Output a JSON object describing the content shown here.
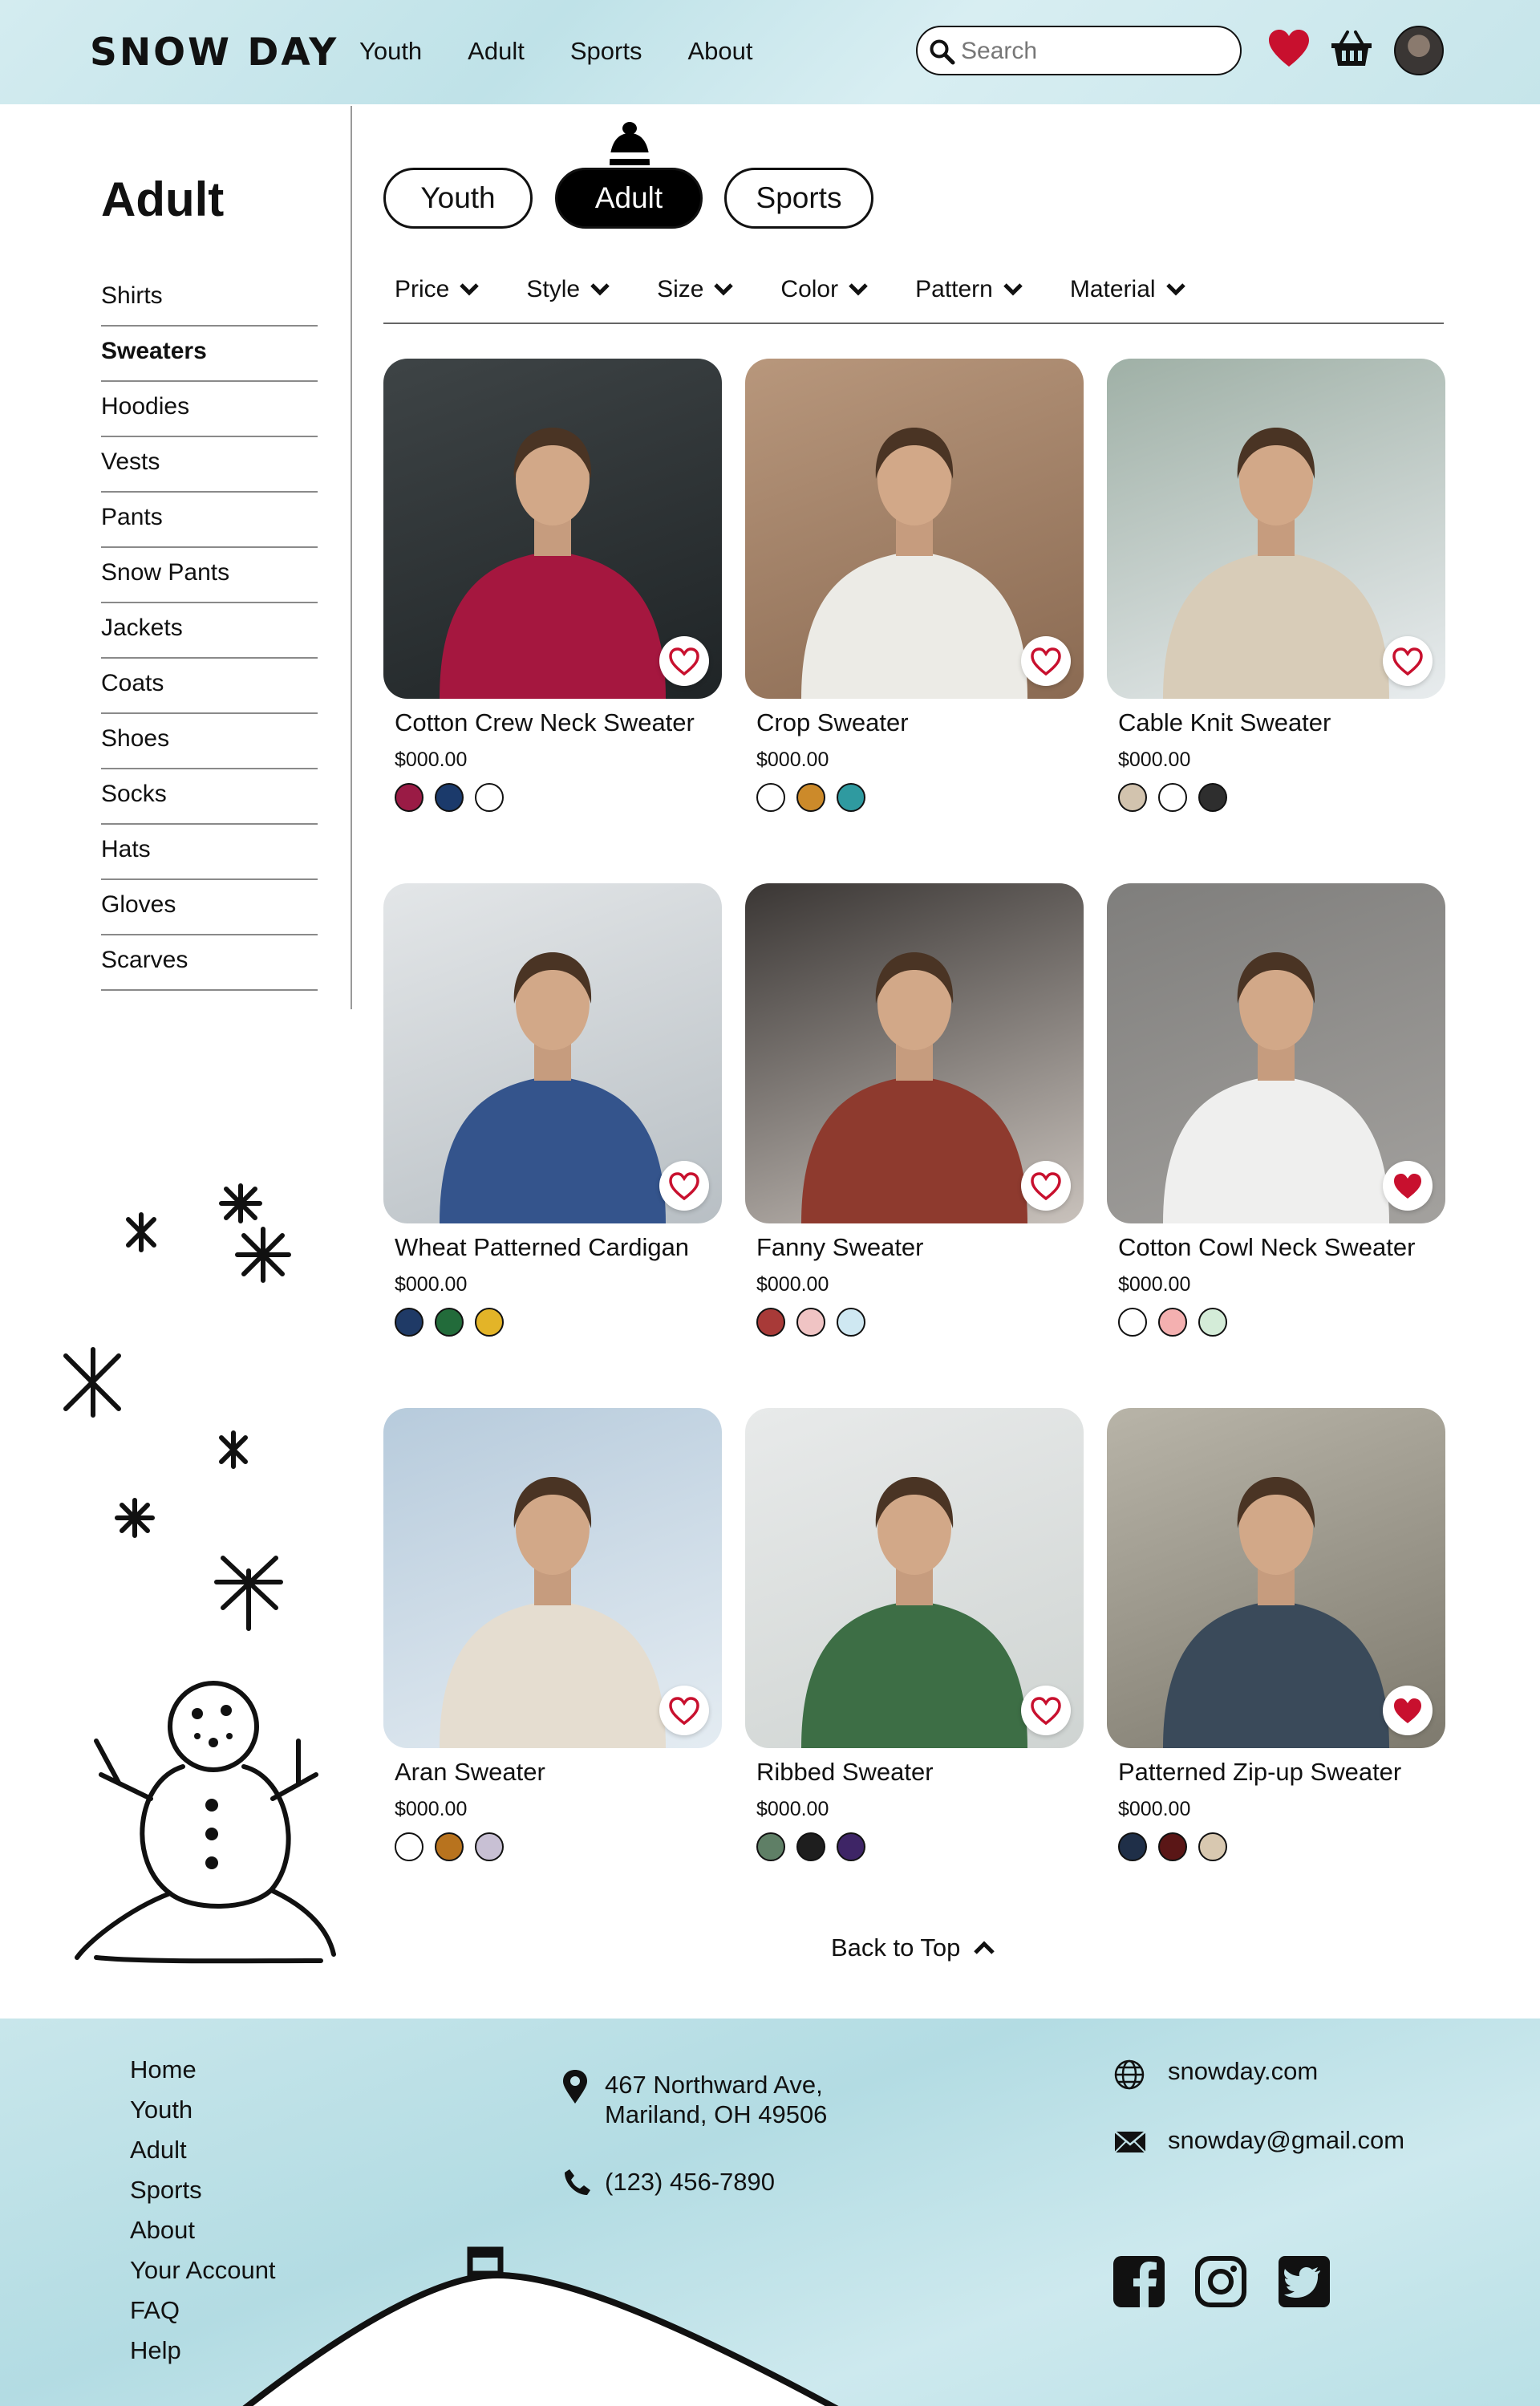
{
  "brand": "SNOW DAY",
  "nav": [
    "Youth",
    "Adult",
    "Sports",
    "About"
  ],
  "search": {
    "placeholder": "Search"
  },
  "sidebar": {
    "title": "Adult",
    "items": [
      "Shirts",
      "Sweaters",
      "Hoodies",
      "Vests",
      "Pants",
      "Snow Pants",
      "Jackets",
      "Coats",
      "Shoes",
      "Socks",
      "Hats",
      "Gloves",
      "Scarves"
    ],
    "active": "Sweaters"
  },
  "tabs": [
    {
      "label": "Youth",
      "active": false
    },
    {
      "label": "Adult",
      "active": true
    },
    {
      "label": "Sports",
      "active": false
    }
  ],
  "filters": [
    "Price",
    "Style",
    "Size",
    "Color",
    "Pattern",
    "Material"
  ],
  "products": [
    {
      "name": "Cotton Crew Neck Sweater",
      "price": "$000.00",
      "favorited": false,
      "icon": "crewneck-photo",
      "bg": [
        "#3e4446",
        "#1f2426"
      ],
      "figure": "#a5173f",
      "colors": [
        "#9a1b45",
        "#1b3a6b",
        "#ffffff"
      ]
    },
    {
      "name": "Crop Sweater",
      "price": "$000.00",
      "favorited": false,
      "icon": "crop-photo",
      "bg": [
        "#b8977c",
        "#8a6a52"
      ],
      "figure": "#ecebe6",
      "colors": [
        "#ffffff",
        "#cc8a2a",
        "#2f9aa0"
      ]
    },
    {
      "name": "Cable Knit Sweater",
      "price": "$000.00",
      "favorited": false,
      "icon": "cable-photo",
      "bg": [
        "#9fb0a6",
        "#e8ecee"
      ],
      "figure": "#d8ccb8",
      "colors": [
        "#d2c3ae",
        "#ffffff",
        "#2e2e2e"
      ]
    },
    {
      "name": "Wheat Patterned Cardigan",
      "price": "$000.00",
      "favorited": false,
      "icon": "cardigan-photo",
      "bg": [
        "#e3e6e8",
        "#b8bfc4"
      ],
      "figure": "#34548c",
      "colors": [
        "#1f3a66",
        "#226b3a",
        "#e3b428"
      ]
    },
    {
      "name": "Fanny Sweater",
      "price": "$000.00",
      "favorited": false,
      "icon": "fanny-photo",
      "bg": [
        "#3a3634",
        "#c9c2bc"
      ],
      "figure": "#8e3a2e",
      "colors": [
        "#a83a38",
        "#f0c4c4",
        "#cfe8f2"
      ]
    },
    {
      "name": "Cotton Cowl Neck Sweater",
      "price": "$000.00",
      "favorited": true,
      "icon": "cowl-photo",
      "bg": [
        "#7f7e7c",
        "#a3a19e"
      ],
      "figure": "#efefee",
      "colors": [
        "#ffffff",
        "#f4b0b0",
        "#d4ecd8"
      ]
    },
    {
      "name": "Aran Sweater",
      "price": "$000.00",
      "favorited": false,
      "icon": "aran-photo",
      "bg": [
        "#b7cbdc",
        "#e4ecf2"
      ],
      "figure": "#e5ddd0",
      "colors": [
        "#ffffff",
        "#b8731e",
        "#c8c0d4"
      ]
    },
    {
      "name": "Ribbed Sweater",
      "price": "$000.00",
      "favorited": false,
      "icon": "ribbed-photo",
      "bg": [
        "#e8eaea",
        "#cfd4d2"
      ],
      "figure": "#3d6e45",
      "colors": [
        "#5f7f66",
        "#1e1e1e",
        "#3e2566"
      ]
    },
    {
      "name": "Patterned Zip-up Sweater",
      "price": "$000.00",
      "favorited": true,
      "icon": "zipup-photo",
      "bg": [
        "#b8b4a8",
        "#7e7a6e"
      ],
      "figure": "#3a4a5a",
      "colors": [
        "#1f2f48",
        "#5a1616",
        "#d8c8b0"
      ]
    }
  ],
  "back_to_top": "Back to Top",
  "footer": {
    "links": [
      "Home",
      "Youth",
      "Adult",
      "Sports",
      "About",
      "Your Account",
      "FAQ",
      "Help"
    ],
    "address_line1": "467 Northward Ave,",
    "address_line2": "Mariland, OH 49506",
    "phone": "(123) 456-7890",
    "website": "snowday.com",
    "email": "snowday@gmail.com"
  },
  "accent": "#c8102e"
}
